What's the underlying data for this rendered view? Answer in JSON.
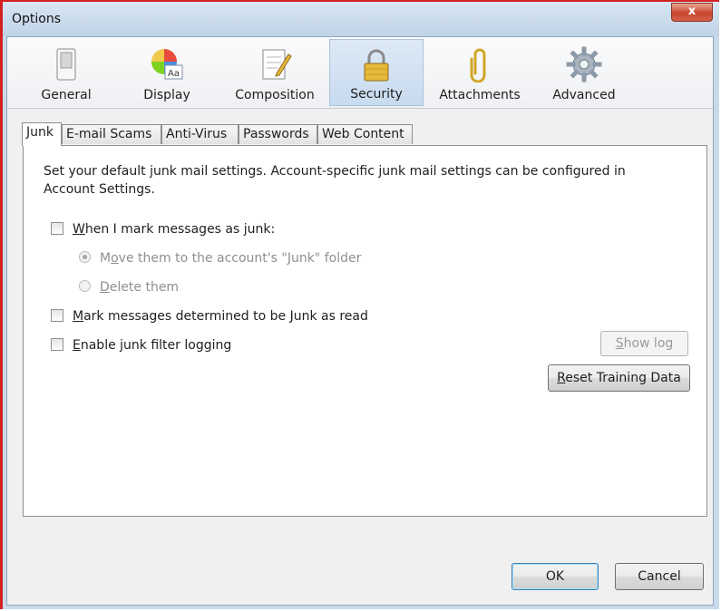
{
  "window": {
    "title": "Options",
    "close_label": "x"
  },
  "toolbar": {
    "panes": [
      {
        "label": "General",
        "icon": "switch-icon"
      },
      {
        "label": "Display",
        "icon": "color-wheel-icon"
      },
      {
        "label": "Composition",
        "icon": "notepad-pencil-icon"
      },
      {
        "label": "Security",
        "icon": "padlock-icon",
        "selected": true
      },
      {
        "label": "Attachments",
        "icon": "paperclip-icon"
      },
      {
        "label": "Advanced",
        "icon": "gear-icon"
      }
    ]
  },
  "tabs": [
    {
      "label": "Junk",
      "active": true
    },
    {
      "label": "E-mail Scams"
    },
    {
      "label": "Anti-Virus"
    },
    {
      "label": "Passwords"
    },
    {
      "label": "Web Content"
    }
  ],
  "junk": {
    "description": "Set your default junk mail settings. Account-specific junk mail settings can be configured in Account Settings.",
    "when_mark_checkbox": {
      "label_u": "W",
      "label_rest": "hen I mark messages as junk:",
      "checked": false
    },
    "move_radio": {
      "label_pre": "M",
      "label_u": "o",
      "label_rest": "ve them to the account's \"Junk\" folder",
      "selected": true,
      "enabled": false
    },
    "delete_radio": {
      "label_u": "D",
      "label_rest": "elete them",
      "selected": false,
      "enabled": false
    },
    "mark_read_checkbox": {
      "label_u": "M",
      "label_rest": "ark messages determined to be Junk as read",
      "checked": false
    },
    "logging_checkbox": {
      "label_u": "E",
      "label_rest": "nable junk filter logging",
      "checked": false
    },
    "show_log_button": {
      "label_u": "S",
      "label_rest": "how log",
      "enabled": false
    },
    "reset_button": {
      "label_u": "R",
      "label_rest": "eset Training Data"
    }
  },
  "footer": {
    "ok_label": "OK",
    "cancel_label": "Cancel"
  }
}
